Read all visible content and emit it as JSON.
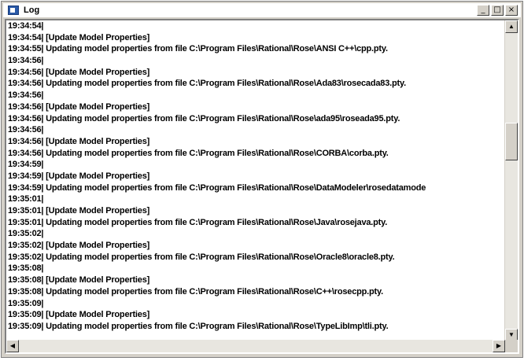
{
  "window": {
    "title": "Log",
    "controls": {
      "minimize": "_",
      "maximize": "□",
      "close": "×"
    }
  },
  "log": {
    "lines": [
      "19:34:54|",
      "19:34:54|  [Update Model Properties]",
      "19:34:55|    Updating model properties from file C:\\Program Files\\Rational\\Rose\\ANSI C++\\cpp.pty.",
      "19:34:56|",
      "19:34:56|  [Update Model Properties]",
      "19:34:56|    Updating model properties from file C:\\Program Files\\Rational\\Rose\\Ada83\\rosecada83.pty.",
      "19:34:56|",
      "19:34:56|  [Update Model Properties]",
      "19:34:56|    Updating model properties from file C:\\Program Files\\Rational\\Rose\\ada95\\roseada95.pty.",
      "19:34:56|",
      "19:34:56|  [Update Model Properties]",
      "19:34:56|    Updating model properties from file C:\\Program Files\\Rational\\Rose\\CORBA\\corba.pty.",
      "19:34:59|",
      "19:34:59|  [Update Model Properties]",
      "19:34:59|    Updating model properties from file C:\\Program Files\\Rational\\Rose\\DataModeler\\rosedatamode",
      "19:35:01|",
      "19:35:01|  [Update Model Properties]",
      "19:35:01|    Updating model properties from file C:\\Program Files\\Rational\\Rose\\Java\\rosejava.pty.",
      "19:35:02|",
      "19:35:02|  [Update Model Properties]",
      "19:35:02|    Updating model properties from file C:\\Program Files\\Rational\\Rose\\Oracle8\\oracle8.pty.",
      "19:35:08|",
      "19:35:08|  [Update Model Properties]",
      "19:35:08|    Updating model properties from file C:\\Program Files\\Rational\\Rose\\C++\\rosecpp.pty.",
      "19:35:09|",
      "19:35:09|  [Update Model Properties]",
      "19:35:09|    Updating model properties from file C:\\Program Files\\Rational\\Rose\\TypeLibImp\\tli.pty."
    ]
  },
  "scrollbars": {
    "up": "▲",
    "down": "▼",
    "left": "◀",
    "right": "▶"
  }
}
